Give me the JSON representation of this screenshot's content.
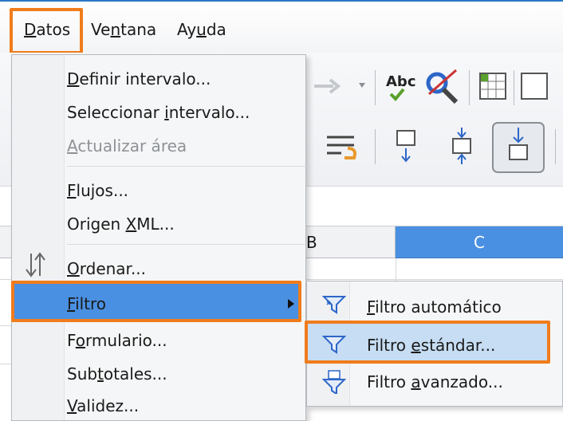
{
  "menubar": {
    "items": [
      {
        "label": "Datos",
        "underline": "D"
      },
      {
        "label": "Ventana",
        "underline": "n"
      },
      {
        "label": "Ayuda",
        "underline": "u"
      }
    ]
  },
  "spreadsheet": {
    "column_b": "B",
    "column_c": "C"
  },
  "toolbar": {
    "spellcheck_label": "Abc"
  },
  "datos_menu": {
    "items": [
      {
        "pre": "",
        "ul": "D",
        "post": "efinir intervalo...",
        "disabled": false
      },
      {
        "pre": "Seleccionar ",
        "ul": "i",
        "post": "ntervalo...",
        "disabled": false
      },
      {
        "pre": "",
        "ul": "A",
        "post": "ctualizar área",
        "disabled": true
      },
      {
        "pre": "",
        "ul": "F",
        "post": "lujos...",
        "disabled": false
      },
      {
        "pre": "Origen ",
        "ul": "X",
        "post": "ML...",
        "disabled": false
      },
      {
        "pre": "",
        "ul": "O",
        "post": "rdenar...",
        "disabled": false
      },
      {
        "pre": "",
        "ul": "F",
        "post": "iltro",
        "disabled": false
      },
      {
        "pre": "F",
        "ul": "o",
        "post": "rmulario...",
        "disabled": false
      },
      {
        "pre": "Sub",
        "ul": "t",
        "post": "otales...",
        "disabled": false
      },
      {
        "pre": "",
        "ul": "V",
        "post": "alidez...",
        "disabled": false
      }
    ]
  },
  "filtro_submenu": {
    "items": [
      {
        "pre": "",
        "ul": "F",
        "post": "iltro automático"
      },
      {
        "pre": "Filtro ",
        "ul": "e",
        "post": "stándar..."
      },
      {
        "pre": "Filtro ",
        "ul": "a",
        "post": "vanzado..."
      }
    ]
  },
  "colors": {
    "highlight_orange": "#f07c1c",
    "selection_blue": "#4a90e2",
    "hover_light_blue": "#c6ddf3"
  }
}
